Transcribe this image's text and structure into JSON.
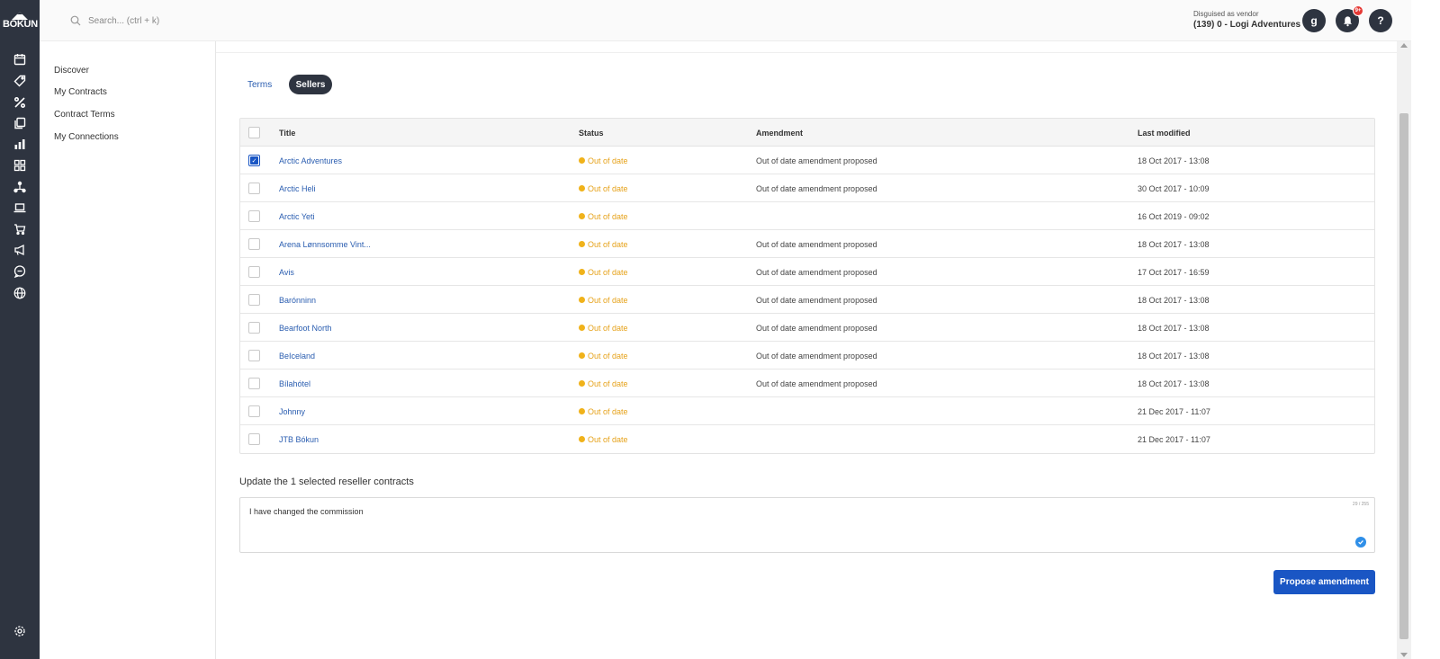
{
  "app": {
    "logo_text": "BÓKUN"
  },
  "search": {
    "placeholder": "Search... (ctrl + k)"
  },
  "vendor": {
    "label": "Disguised as vendor",
    "name": "(139) 0 - Logi Adventures"
  },
  "user": {
    "initial": "g"
  },
  "notifications": {
    "badge": "9+"
  },
  "help": {
    "label": "?"
  },
  "rail_icons": [
    "calendar-icon",
    "tag-icon",
    "percent-icon",
    "copy-icon",
    "bar-chart-icon",
    "widgets-icon",
    "network-icon",
    "laptop-icon",
    "cart-icon",
    "megaphone-icon",
    "chat-icon",
    "globe-icon",
    "settings-icon"
  ],
  "leftnav": {
    "items": [
      {
        "label": "Discover"
      },
      {
        "label": "My Contracts"
      },
      {
        "label": "Contract Terms"
      },
      {
        "label": "My Connections"
      }
    ]
  },
  "tabs": {
    "terms": "Terms",
    "sellers": "Sellers"
  },
  "table": {
    "headers": {
      "title": "Title",
      "status": "Status",
      "amendment": "Amendment",
      "modified": "Last modified"
    },
    "rows": [
      {
        "title": "Arctic Adventures",
        "status": "Out of date",
        "amendment": "Out of date amendment proposed",
        "modified": "18 Oct 2017 - 13:08",
        "checked": true
      },
      {
        "title": "Arctic Heli",
        "status": "Out of date",
        "amendment": "Out of date amendment proposed",
        "modified": "30 Oct 2017 - 10:09",
        "checked": false
      },
      {
        "title": "Arctic Yeti",
        "status": "Out of date",
        "amendment": "",
        "modified": "16 Oct 2019 - 09:02",
        "checked": false
      },
      {
        "title": "Arena Lønnsomme Vint...",
        "status": "Out of date",
        "amendment": "Out of date amendment proposed",
        "modified": "18 Oct 2017 - 13:08",
        "checked": false
      },
      {
        "title": "Avis",
        "status": "Out of date",
        "amendment": "Out of date amendment proposed",
        "modified": "17 Oct 2017 - 16:59",
        "checked": false
      },
      {
        "title": "Barónninn",
        "status": "Out of date",
        "amendment": "Out of date amendment proposed",
        "modified": "18 Oct 2017 - 13:08",
        "checked": false
      },
      {
        "title": "Bearfoot North",
        "status": "Out of date",
        "amendment": "Out of date amendment proposed",
        "modified": "18 Oct 2017 - 13:08",
        "checked": false
      },
      {
        "title": "BeIceland",
        "status": "Out of date",
        "amendment": "Out of date amendment proposed",
        "modified": "18 Oct 2017 - 13:08",
        "checked": false
      },
      {
        "title": "Bílahótel",
        "status": "Out of date",
        "amendment": "Out of date amendment proposed",
        "modified": "18 Oct 2017 - 13:08",
        "checked": false
      },
      {
        "title": "Johnny",
        "status": "Out of date",
        "amendment": "",
        "modified": "21 Dec 2017 - 11:07",
        "checked": false
      },
      {
        "title": "JTB Bókun",
        "status": "Out of date",
        "amendment": "",
        "modified": "21 Dec 2017 - 11:07",
        "checked": false
      }
    ]
  },
  "update": {
    "label": "Update the 1 selected reseller contracts",
    "value": "I have changed the commission",
    "counter": "29 / 255"
  },
  "actions": {
    "propose": "Propose amendment"
  },
  "colors": {
    "rail": "#2e3440",
    "accent": "#1a56c4",
    "link": "#2a5db0",
    "warning": "#f0b21a"
  }
}
